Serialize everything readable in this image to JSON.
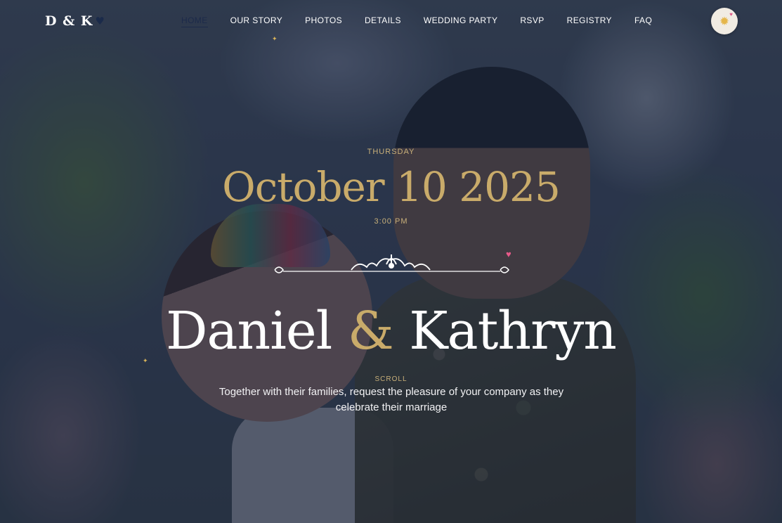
{
  "logo": {
    "text": "D & K",
    "icon": "heart-icon"
  },
  "nav": {
    "items": [
      {
        "label": "HOME",
        "active": true
      },
      {
        "label": "OUR STORY"
      },
      {
        "label": "PHOTOS"
      },
      {
        "label": "DETAILS"
      },
      {
        "label": "WEDDING PARTY"
      },
      {
        "label": "RSVP"
      },
      {
        "label": "REGISTRY"
      },
      {
        "label": "FAQ"
      }
    ],
    "theme_toggle_icon": "sun-icon"
  },
  "hero": {
    "day": "THURSDAY",
    "date": "October 10 2025",
    "time": "3:00 PM",
    "name_first": "Daniel",
    "ampersand": "&",
    "name_second": "Kathryn",
    "scroll_label": "SCROLL",
    "invitation": "Together with their families, request the pleasure of your company as they celebrate their marriage"
  },
  "colors": {
    "accent_gold": "#c9ab6a",
    "overlay": "#161c30",
    "heart_pink": "#e85a8a"
  }
}
